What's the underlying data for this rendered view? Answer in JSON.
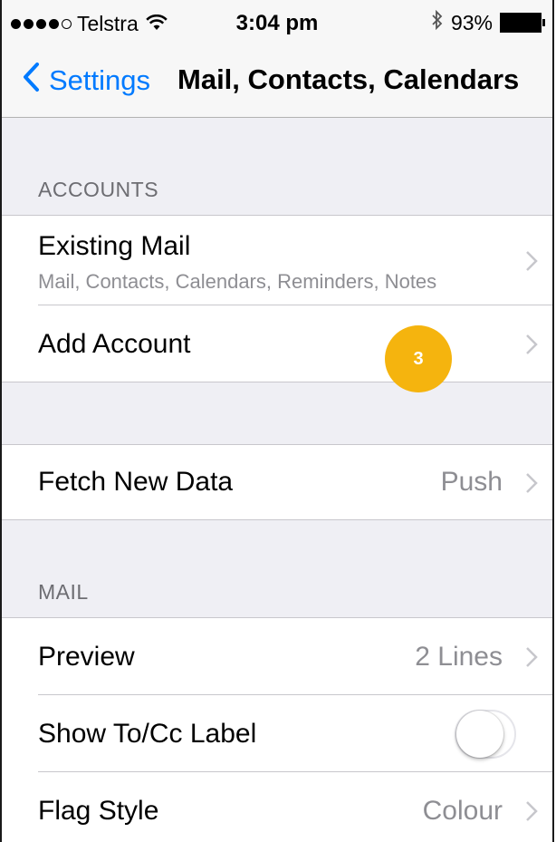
{
  "status_bar": {
    "carrier": "Telstra",
    "time": "3:04 pm",
    "battery": "93%",
    "signal_bars_filled": 4,
    "signal_bars_total": 5
  },
  "nav": {
    "back_label": "Settings",
    "title": "Mail, Contacts, Calendars"
  },
  "accounts": {
    "header": "ACCOUNTS",
    "existing": {
      "label": "Existing Mail",
      "sublabel": "Mail, Contacts, Calendars, Reminders, Notes"
    },
    "add_account": {
      "label": "Add Account",
      "badge": "3"
    }
  },
  "fetch": {
    "label": "Fetch New Data",
    "value": "Push"
  },
  "mail": {
    "header": "MAIL",
    "preview": {
      "label": "Preview",
      "value": "2 Lines"
    },
    "show_tocc": {
      "label": "Show To/Cc Label",
      "on": false
    },
    "flag_style": {
      "label": "Flag Style",
      "value": "Colour"
    }
  },
  "colors": {
    "accent": "#007aff",
    "badge": "#f5b40e",
    "background": "#efeff4",
    "secondary_text": "#8e8e93"
  }
}
